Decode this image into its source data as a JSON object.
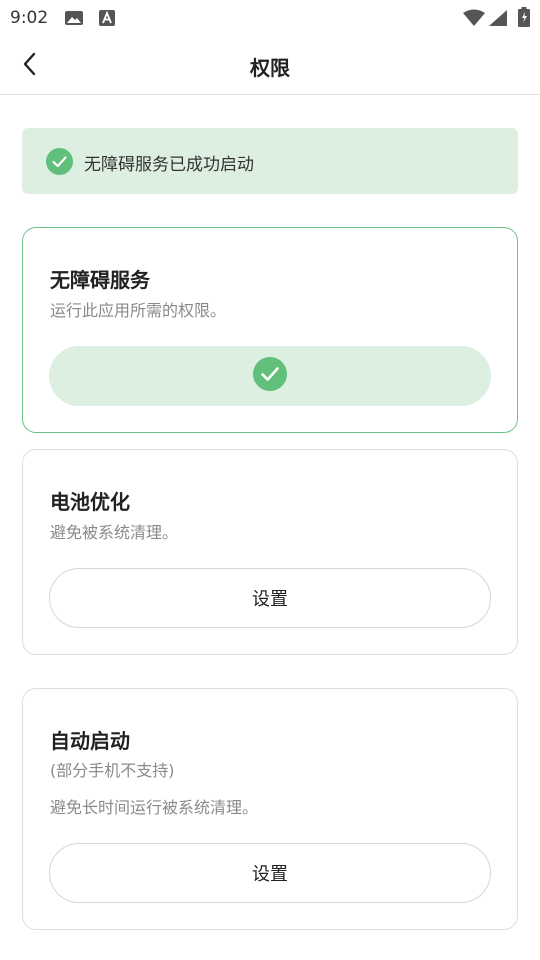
{
  "status_bar": {
    "time": "9:02"
  },
  "app_bar": {
    "title": "权限"
  },
  "banner": {
    "text": "无障碍服务已成功启动"
  },
  "cards": [
    {
      "title": "无障碍服务",
      "description": "运行此应用所需的权限。",
      "state": "enabled"
    },
    {
      "title": "电池优化",
      "description": "避免被系统清理。",
      "button_label": "设置"
    },
    {
      "title": "自动启动",
      "note": "(部分手机不支持)",
      "description": "避免长时间运行被系统清理。",
      "button_label": "设置"
    }
  ],
  "colors": {
    "accent": "#5fbf7b",
    "success_bg": "#dcefe1",
    "active_border": "#6cc386"
  }
}
